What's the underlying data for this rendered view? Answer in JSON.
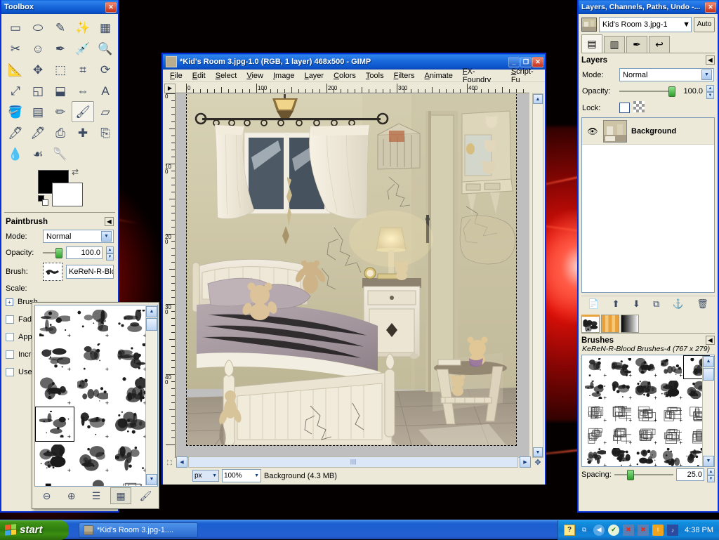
{
  "desktop": {
    "wallpaper_desc": "black background with red light burst"
  },
  "toolbox": {
    "title": "Toolbox",
    "close_label": "✕",
    "tools": [
      {
        "name": "rect-select-tool",
        "glyph": "▭"
      },
      {
        "name": "ellipse-select-tool",
        "glyph": "⬭"
      },
      {
        "name": "free-select-tool",
        "glyph": "✎"
      },
      {
        "name": "fuzzy-select-tool",
        "glyph": "✨"
      },
      {
        "name": "select-by-color-tool",
        "glyph": "▦"
      },
      {
        "name": "scissors-select-tool",
        "glyph": "✂"
      },
      {
        "name": "foreground-select-tool",
        "glyph": "☺"
      },
      {
        "name": "paths-tool",
        "glyph": "✒"
      },
      {
        "name": "color-picker-tool",
        "glyph": "💉"
      },
      {
        "name": "zoom-tool",
        "glyph": "🔍"
      },
      {
        "name": "measure-tool",
        "glyph": "📐"
      },
      {
        "name": "move-tool",
        "glyph": "✥"
      },
      {
        "name": "align-tool",
        "glyph": "⬚"
      },
      {
        "name": "crop-tool",
        "glyph": "⌗"
      },
      {
        "name": "rotate-tool",
        "glyph": "⟳"
      },
      {
        "name": "scale-tool",
        "glyph": "⤢"
      },
      {
        "name": "shear-tool",
        "glyph": "◱"
      },
      {
        "name": "perspective-tool",
        "glyph": "⬓"
      },
      {
        "name": "flip-tool",
        "glyph": "⇔"
      },
      {
        "name": "text-tool",
        "glyph": "A"
      },
      {
        "name": "bucket-fill-tool",
        "glyph": "🪣"
      },
      {
        "name": "blend-gradient-tool",
        "glyph": "▤"
      },
      {
        "name": "pencil-tool",
        "glyph": "✏"
      },
      {
        "name": "paintbrush-tool",
        "glyph": "🖌"
      },
      {
        "name": "eraser-tool",
        "glyph": "▱"
      },
      {
        "name": "airbrush-tool",
        "glyph": "🖊"
      },
      {
        "name": "ink-tool",
        "glyph": "🖋"
      },
      {
        "name": "clone-tool",
        "glyph": "⎙"
      },
      {
        "name": "heal-tool",
        "glyph": "✚"
      },
      {
        "name": "perspective-clone-tool",
        "glyph": "⎘"
      },
      {
        "name": "blur-sharpen-tool",
        "glyph": "💧"
      },
      {
        "name": "smudge-tool",
        "glyph": "☙"
      },
      {
        "name": "dodge-burn-tool",
        "glyph": "🥄"
      }
    ],
    "active_tool_index": 23,
    "foreground_color": "#000000",
    "background_color": "#ffffff"
  },
  "tool_options": {
    "title": "Paintbrush",
    "mode_label": "Mode:",
    "mode_value": "Normal",
    "opacity_label": "Opacity:",
    "opacity_value": "100.0",
    "brush_label": "Brush:",
    "brush_value": "KeReN-R-Blood Br",
    "scale_label": "Scale:",
    "checkboxes": [
      {
        "label": "Brush",
        "type": "expander"
      },
      {
        "label": "Fade",
        "type": "check"
      },
      {
        "label": "Appl",
        "type": "check"
      },
      {
        "label": "Incre",
        "type": "check"
      },
      {
        "label": "Use",
        "type": "check"
      }
    ]
  },
  "brush_popup": {
    "zoom_out_icon": "⊖",
    "zoom_in_icon": "⊕",
    "list_view_icon": "☰",
    "grid_view_icon": "▦",
    "edit_brush_icon": "🖌",
    "selected_index": 9
  },
  "image_window": {
    "title": "*Kid's Room 3.jpg-1.0 (RGB, 1 layer) 468x500 - GIMP",
    "minimize_label": "_",
    "maximize_label": "❐",
    "close_label": "✕",
    "menus": [
      "File",
      "Edit",
      "Select",
      "View",
      "Image",
      "Layer",
      "Colors",
      "Tools",
      "Filters",
      "Animate",
      "FX-Foundry",
      "Script-Fu"
    ],
    "h_ruler_ticks": [
      "0",
      "100",
      "200",
      "300",
      "400"
    ],
    "v_ruler_ticks": [
      "0",
      "100",
      "200",
      "300",
      "400"
    ],
    "status": {
      "unit": "px",
      "zoom": "100%",
      "text": "Background (4.3 MB)"
    }
  },
  "dock": {
    "title": "Layers, Channels, Paths, Undo -...",
    "close_label": "✕",
    "image_combo_value": "Kid's Room 3.jpg-1",
    "auto_label": "Auto",
    "tabs": [
      {
        "name": "layers-tab",
        "glyph": "▤"
      },
      {
        "name": "channels-tab",
        "glyph": "▥"
      },
      {
        "name": "paths-tab",
        "glyph": "✒"
      },
      {
        "name": "undo-history-tab",
        "glyph": "↩"
      }
    ],
    "layers_panel": {
      "title": "Layers",
      "mode_label": "Mode:",
      "mode_value": "Normal",
      "opacity_label": "Opacity:",
      "opacity_value": "100.0",
      "lock_label": "Lock:",
      "layers": [
        {
          "name": "Background",
          "visible": true
        }
      ],
      "buttons": [
        {
          "name": "new-layer-button",
          "glyph": "📄"
        },
        {
          "name": "raise-layer-button",
          "glyph": "⬆"
        },
        {
          "name": "lower-layer-button",
          "glyph": "⬇"
        },
        {
          "name": "duplicate-layer-button",
          "glyph": "⧉"
        },
        {
          "name": "anchor-layer-button",
          "glyph": "⚓"
        },
        {
          "name": "delete-layer-button",
          "glyph": "🗑"
        }
      ]
    },
    "brushes_panel": {
      "title": "Brushes",
      "subtitle": "KeReN-R-Blood Brushes-4 (767 x 279)",
      "tabs": [
        {
          "name": "brushes-tab",
          "glyph": "🖌"
        },
        {
          "name": "patterns-tab",
          "glyph": "▥"
        },
        {
          "name": "gradients-tab",
          "glyph": "▦"
        }
      ],
      "spacing_label": "Spacing:",
      "spacing_value": "25.0",
      "selected_index": 4
    }
  },
  "taskbar": {
    "start_label": "start",
    "tasks": [
      {
        "label": "*Kid's Room 3.jpg-1...."
      }
    ],
    "tray": {
      "icons": [
        "help-icon",
        "show-desktop-icon",
        "back-icon",
        "shield-icon",
        "network-disconnected-icon",
        "network-disconnected-icon-2",
        "update-icon",
        "volume-icon"
      ],
      "clock": "4:38 PM"
    }
  }
}
